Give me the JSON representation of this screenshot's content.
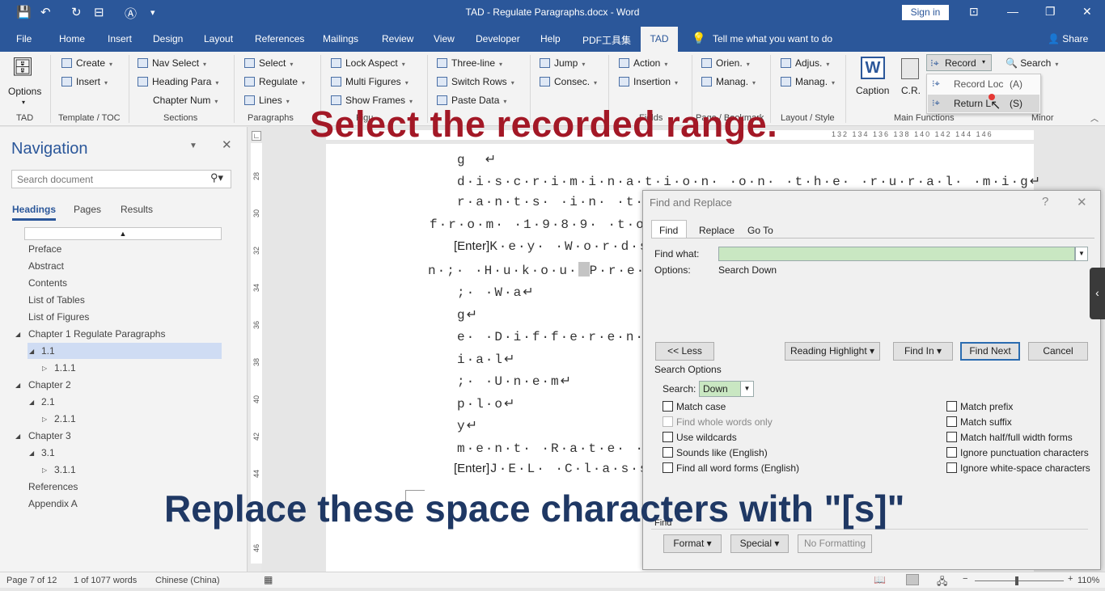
{
  "window": {
    "title": "TAD - Regulate Paragraphs.docx - Word",
    "sign_in": "Sign in"
  },
  "tabs": [
    "File",
    "Home",
    "Insert",
    "Design",
    "Layout",
    "References",
    "Mailings",
    "Review",
    "View",
    "Developer",
    "Help",
    "PDF工具集",
    "TAD"
  ],
  "tell_me": "Tell me what you want to do",
  "share": "Share",
  "ribbon": {
    "options": "Options",
    "create": "Create",
    "insert": "Insert",
    "nav_select": "Nav Select",
    "heading_para": "Heading Para",
    "chapter_num": "Chapter Num",
    "select": "Select",
    "regulate": "Regulate",
    "lines": "Lines",
    "lock_aspect": "Lock Aspect",
    "multi_figures": "Multi Figures",
    "show_frames": "Show Frames",
    "three_line": "Three-line",
    "switch_rows": "Switch Rows",
    "paste_data": "Paste Data",
    "jump": "Jump",
    "consec": "Consec.",
    "action": "Action",
    "insertion": "Insertion",
    "orien": "Orien.",
    "manag1": "Manag.",
    "adjus": "Adjus.",
    "manag2": "Manag.",
    "caption": "Caption",
    "cr": "C.R.",
    "record": "Record",
    "search": "Search",
    "record_loc": "Record Loc",
    "record_loc_key": "(A)",
    "return_label": "Return L",
    "return_key": "(S)",
    "groups": {
      "tad": "TAD",
      "template": "Template / TOC",
      "sections": "Sections",
      "paragraphs": "Paragraphs",
      "layout_style": "Layout / Style",
      "main_functions": "Main Functions",
      "minor": "Minor",
      "figures_partial": "Figu",
      "fields_partial": "Fields",
      "page_partial": "Page / Bookmark"
    }
  },
  "overlay": {
    "top": "Select the recorded range.",
    "bottom": "Replace these space characters with \"[s]\""
  },
  "navigation": {
    "title": "Navigation",
    "search_placeholder": "Search document",
    "tabs": [
      "Headings",
      "Pages",
      "Results"
    ],
    "items": [
      "Preface",
      "Abstract",
      "Contents",
      "List of Tables",
      "List of Figures",
      "Chapter 1 Regulate Paragraphs",
      "1.1",
      "1.1.1",
      "Chapter 2",
      "2.1",
      "2.1.1",
      "Chapter 3",
      "3.1",
      "3.1.1",
      "References",
      "Appendix A"
    ]
  },
  "ruler": {
    "vertical": [
      "28",
      "30",
      "32",
      "34",
      "36",
      "38",
      "40",
      "42",
      "44",
      "46"
    ],
    "horizontal": "132 134 136 138 140 142 144 146"
  },
  "document_lines": [
    "g  ↵",
    "d·i·s·c·r·i·m·i·n·a·t·i·o·n· ·o·n· ·t·h·e· ·r·u·r·a·l· ·m·i·g↵",
    "r·a·n·t·s· ·i·n· ·t·h·e",
    "f·r·o·m· ·1·9·8·9· ·t·o· ·2",
    "K·e·y· ·W·o·r·d·s·;",
    "n·;· ·H·u·k·o·u·",
    "P·r·e·m",
    ";· ·W·a↵",
    "g↵",
    "e· ·D·i·f·f·e·r·e·n·t↵",
    "i·a·l↵",
    ";· ·U·n·e·m↵",
    "p·l·o↵",
    "y↵",
    "m·e·n·t· ·R·a·t·e· · ↵",
    "J·E·L· ·C·l·a·s·s·i"
  ],
  "enter_tag": "[Enter]",
  "dialog": {
    "title": "Find and Replace",
    "help": "?",
    "close": "✕",
    "tabs": [
      "Find",
      "Replace",
      "Go To"
    ],
    "find_what_label": "Find what:",
    "find_what_value": "",
    "options_label": "Options:",
    "options_value": "Search Down",
    "less_btn": "<< Less",
    "reading_highlight_btn": "Reading Highlight ▾",
    "find_in_btn": "Find In ▾",
    "find_next_btn": "Find Next",
    "cancel_btn": "Cancel",
    "search_options_label": "Search Options",
    "search_label": "Search:",
    "search_value": "Down",
    "left_options": [
      "Match case",
      "Find whole words only",
      "Use wildcards",
      "Sounds like (English)",
      "Find all word forms (English)"
    ],
    "right_options": [
      "Match prefix",
      "Match suffix",
      "Match half/full width forms",
      "Ignore punctuation characters",
      "Ignore white-space characters"
    ],
    "find_section_label": "Find",
    "format_btn": "Format ▾",
    "special_btn": "Special ▾",
    "no_formatting_btn": "No Formatting"
  },
  "status": {
    "page": "Page 7 of 12",
    "words": "1 of 1077 words",
    "language": "Chinese (China)",
    "zoom": "110%"
  },
  "colors": {
    "accent": "#2b579a",
    "overlay_red": "#a31826",
    "overlay_blue": "#1f3864",
    "find_field": "#c9e7c2"
  }
}
